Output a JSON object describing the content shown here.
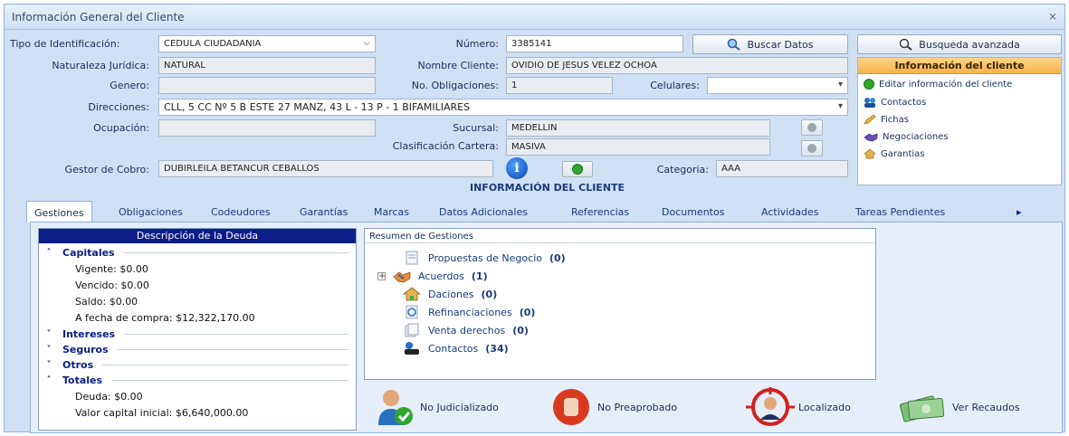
{
  "window": {
    "title": "Información General del Cliente",
    "close": "⨯"
  },
  "form": {
    "tipo_id_label": "Tipo de Identificación:",
    "tipo_id_value": "CEDULA CIUDADANIA",
    "numero_label": "Número:",
    "numero_value": "3385141",
    "buscar_label": "Buscar Datos",
    "busqueda_avanzada_label": "Busqueda avanzada",
    "naturaleza_label": "Naturaleza Jurídica:",
    "naturaleza_value": "NATURAL",
    "nombre_label": "Nombre Cliente:",
    "nombre_value": "OVIDIO DE JESUS VELEZ OCHOA",
    "genero_label": "Genero:",
    "genero_value": "",
    "obligaciones_label": "No. Obligaciones:",
    "obligaciones_value": "1",
    "celulares_label": "Celulares:",
    "celulares_value": "",
    "direcciones_label": "Direcciones:",
    "direcciones_value": "CLL, 5 CC Nº 5 B ESTE 27  MANZ, 43 L - 13 P - 1 BIFAMILIARES",
    "ocupacion_label": "Ocupación:",
    "ocupacion_value": "",
    "sucursal_label": "Sucursal:",
    "sucursal_value": "MEDELLIN",
    "clasificacion_label": "Clasificación Cartera:",
    "clasificacion_value": "MASIVA",
    "gestor_label": "Gestor de Cobro:",
    "gestor_value": "DUBIRLEILA BETANCUR CEBALLOS",
    "categoria_label": "Categoria:",
    "categoria_value": "AAA"
  },
  "info_panel": {
    "header": "Información del cliente",
    "items": [
      "Editar información del cliente",
      "Contactos",
      "Fichas",
      "Negociaciones",
      "Garantias"
    ]
  },
  "section_title": "INFORMACIÓN DEL CLIENTE",
  "tabs": [
    "Gestiones",
    "Obligaciones",
    "Codeudores",
    "Garantías",
    "Marcas",
    "Datos Adicionales",
    "Referencias",
    "Documentos",
    "Actividades",
    "Tareas Pendientes"
  ],
  "tabs_more": "▸",
  "debt": {
    "header": "Descripción de la Deuda",
    "capitales": "Capitales",
    "vigente": "Vigente: $0.00",
    "vencido": "Vencido: $0.00",
    "saldo": "Saldo: $0.00",
    "fecha_compra": "A fecha de compra: $12,322,170.00",
    "intereses": "Intereses",
    "seguros": "Seguros",
    "otros": "Otros",
    "totales": "Totales",
    "deuda": "Deuda: $0.00",
    "valor_capital": "Valor capital inicial: $6,640,000.00"
  },
  "resumen": {
    "header": "Resumen de Gestiones",
    "items": [
      {
        "label": "Propuestas de Negocio",
        "count": "(0)"
      },
      {
        "label": "Acuerdos",
        "count": "(1)"
      },
      {
        "label": "Daciones",
        "count": "(0)"
      },
      {
        "label": "Refinanciaciones",
        "count": "(0)"
      },
      {
        "label": "Venta derechos",
        "count": "(0)"
      },
      {
        "label": "Contactos",
        "count": "(34)"
      }
    ]
  },
  "status": {
    "judicial": "No Judicializado",
    "preaprobado": "No Preaprobado",
    "localizado": "Localizado",
    "recaudos": "Ver Recaudos"
  },
  "colors": {
    "accent": "#0b1d86",
    "panel": "#cfe0f5",
    "orange": "#f6b24a"
  }
}
